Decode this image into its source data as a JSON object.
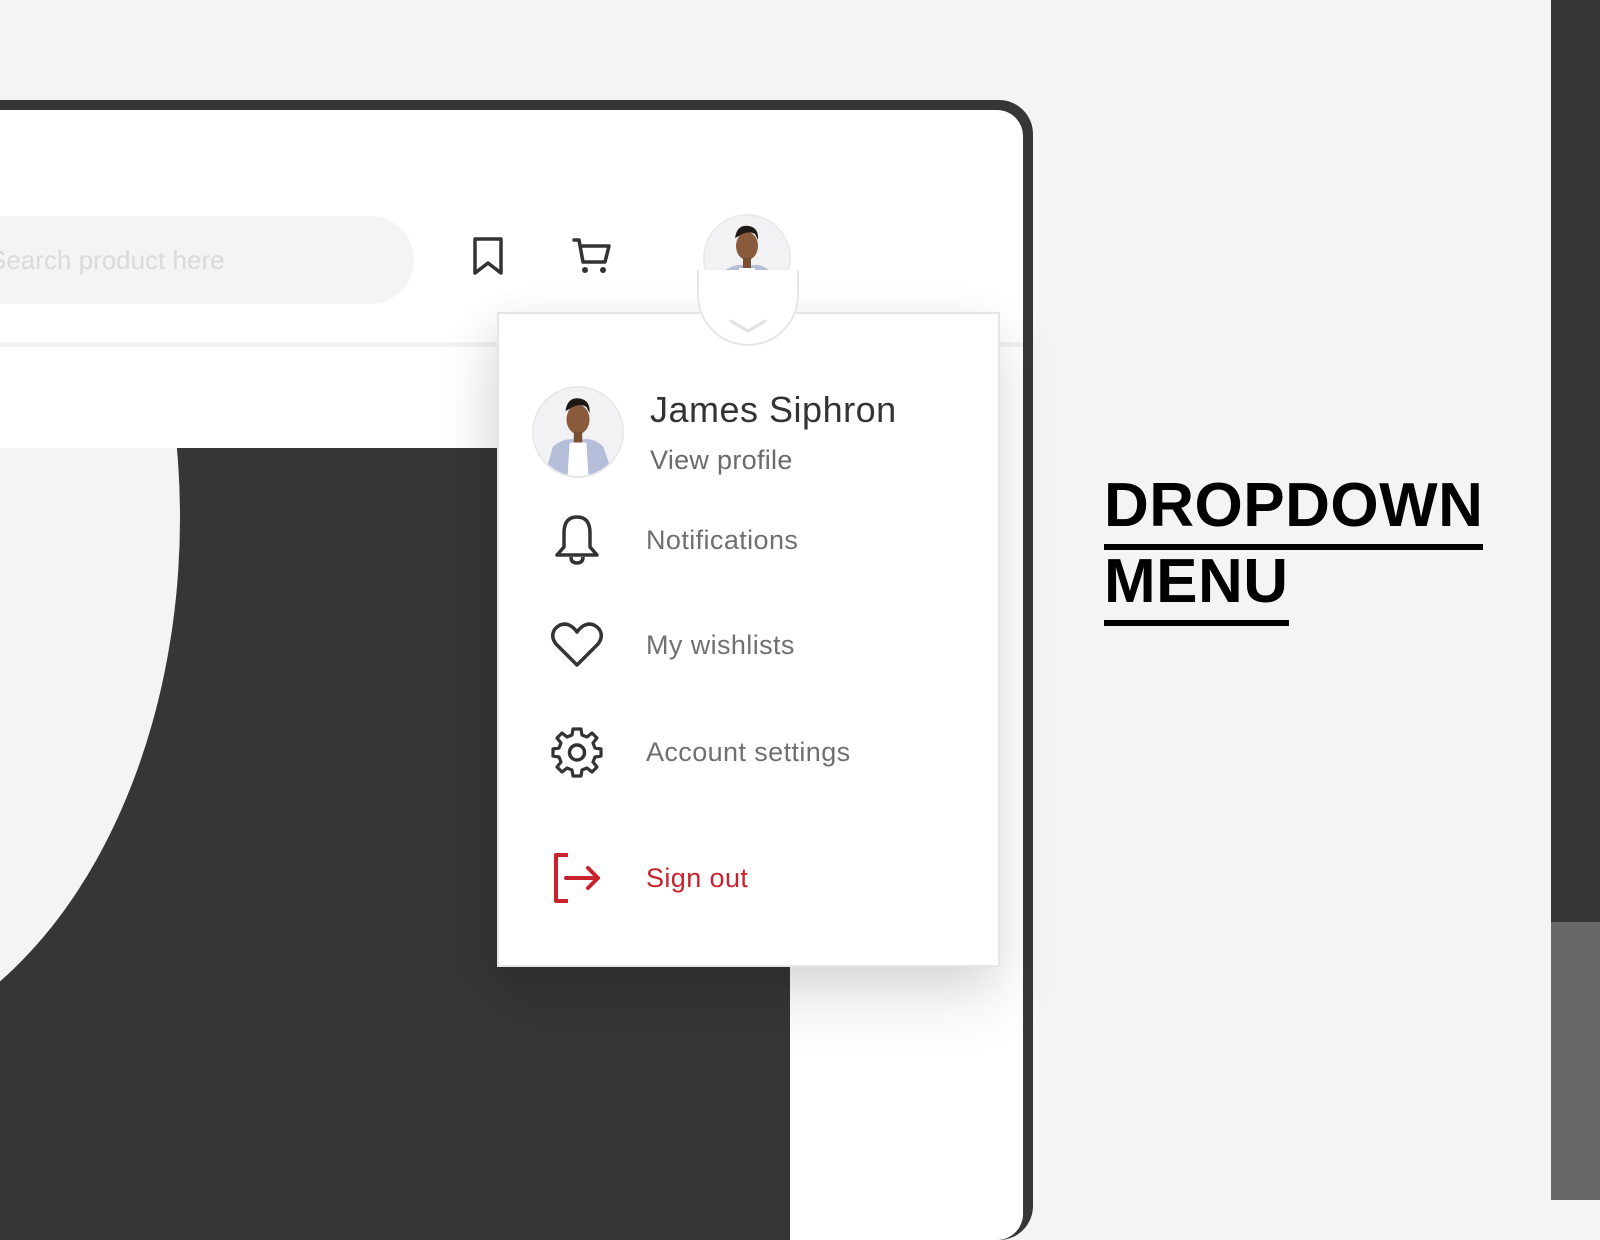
{
  "header": {
    "search": {
      "placeholder": "Search product here",
      "value": ""
    },
    "icons": [
      "bookmark-icon",
      "cart-icon"
    ],
    "avatar_alt": "James Siphron avatar"
  },
  "dropdown": {
    "profile": {
      "name": "James Siphron",
      "link_label": "View profile"
    },
    "items": [
      {
        "label": "Notifications",
        "icon": "bell-icon"
      },
      {
        "label": "My wishlists",
        "icon": "heart-icon"
      },
      {
        "label": "Account settings",
        "icon": "gear-icon"
      }
    ],
    "sign_out": {
      "label": "Sign out",
      "icon": "sign-out-icon"
    }
  },
  "caption": {
    "line1": "DROPDOWN",
    "line2": "MENU"
  },
  "colors": {
    "background": "#f4f4f4",
    "frame": "#363636",
    "danger": "#c8232c",
    "text_primary": "#333333",
    "text_secondary": "#707070"
  }
}
